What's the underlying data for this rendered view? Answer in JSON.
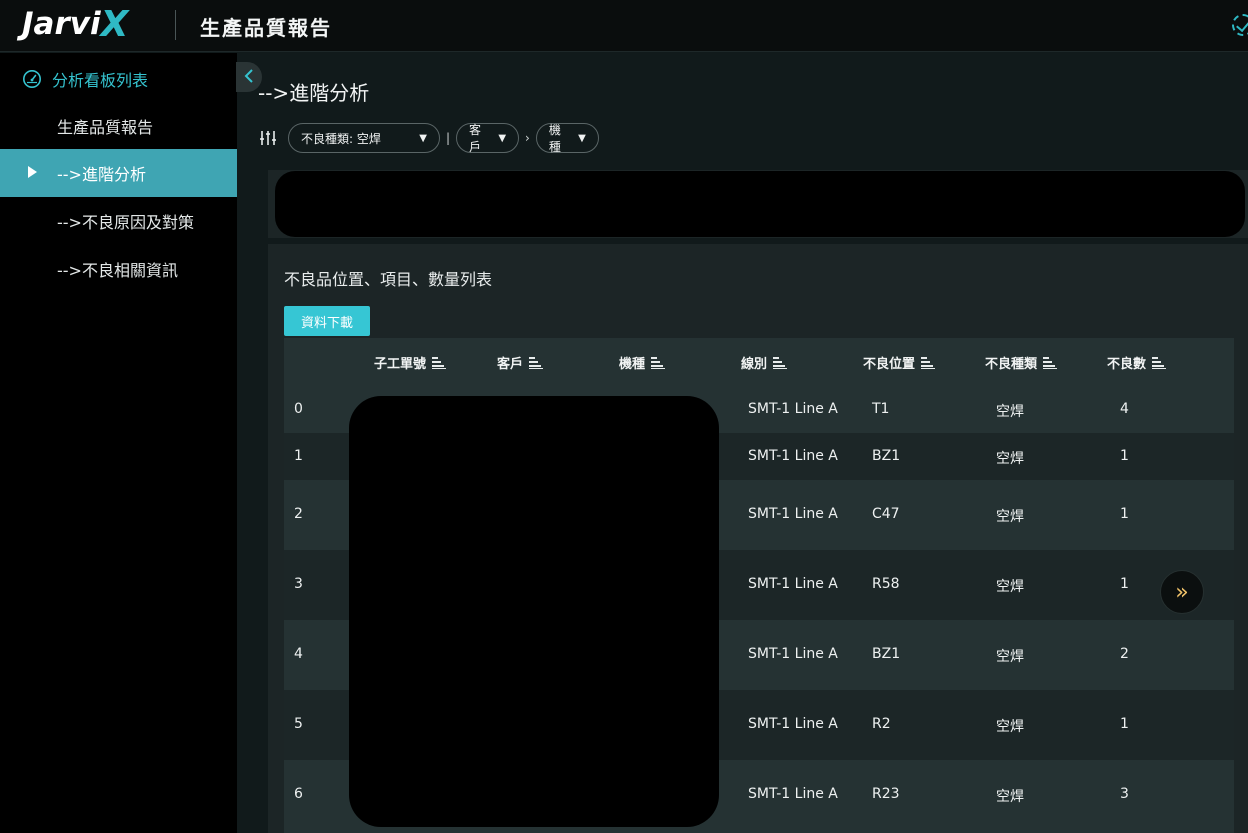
{
  "header": {
    "logo_main": "Jarvi",
    "logo_x": "X",
    "app_title": "生產品質報告"
  },
  "sidebar": {
    "heading": "分析看板列表",
    "items": [
      {
        "label": "生產品質報告",
        "active": false
      },
      {
        "label": "-->進階分析",
        "active": true
      },
      {
        "label": "-->不良原因及對策",
        "active": false
      },
      {
        "label": "-->不良相關資訊",
        "active": false
      }
    ]
  },
  "main": {
    "page_title": "-->進階分析",
    "filters": {
      "defect_type": "不良種類: 空焊",
      "customer": "客戶",
      "model": "機種",
      "separator_1": "|",
      "separator_2": "›"
    },
    "card": {
      "title": "不良品位置、項目、數量列表",
      "download_label": "資料下載",
      "columns": [
        "子工單號",
        "客戶",
        "機種",
        "線別",
        "不良位置",
        "不良種類",
        "不良數"
      ],
      "rows": [
        {
          "index": "0",
          "line": "SMT-1 Line A",
          "position": "T1",
          "type": "空焊",
          "count": "4"
        },
        {
          "index": "1",
          "line": "SMT-1 Line A",
          "position": "BZ1",
          "type": "空焊",
          "count": "1"
        },
        {
          "index": "2",
          "line": "SMT-1 Line A",
          "position": "C47",
          "type": "空焊",
          "count": "1"
        },
        {
          "index": "3",
          "line": "SMT-1 Line A",
          "position": "R58",
          "type": "空焊",
          "count": "1"
        },
        {
          "index": "4",
          "line": "SMT-1 Line A",
          "position": "BZ1",
          "type": "空焊",
          "count": "2"
        },
        {
          "index": "5",
          "line": "SMT-1 Line A",
          "position": "R2",
          "type": "空焊",
          "count": "1"
        },
        {
          "index": "6",
          "line": "SMT-1 Line A",
          "position": "R23",
          "type": "空焊",
          "count": "3"
        }
      ]
    }
  },
  "fab_icon": "»",
  "colors": {
    "accent": "#35c3cf",
    "active_bg": "#3fa5b3",
    "button_bg": "#36c6d4",
    "fab_icon": "#f1c36a"
  }
}
